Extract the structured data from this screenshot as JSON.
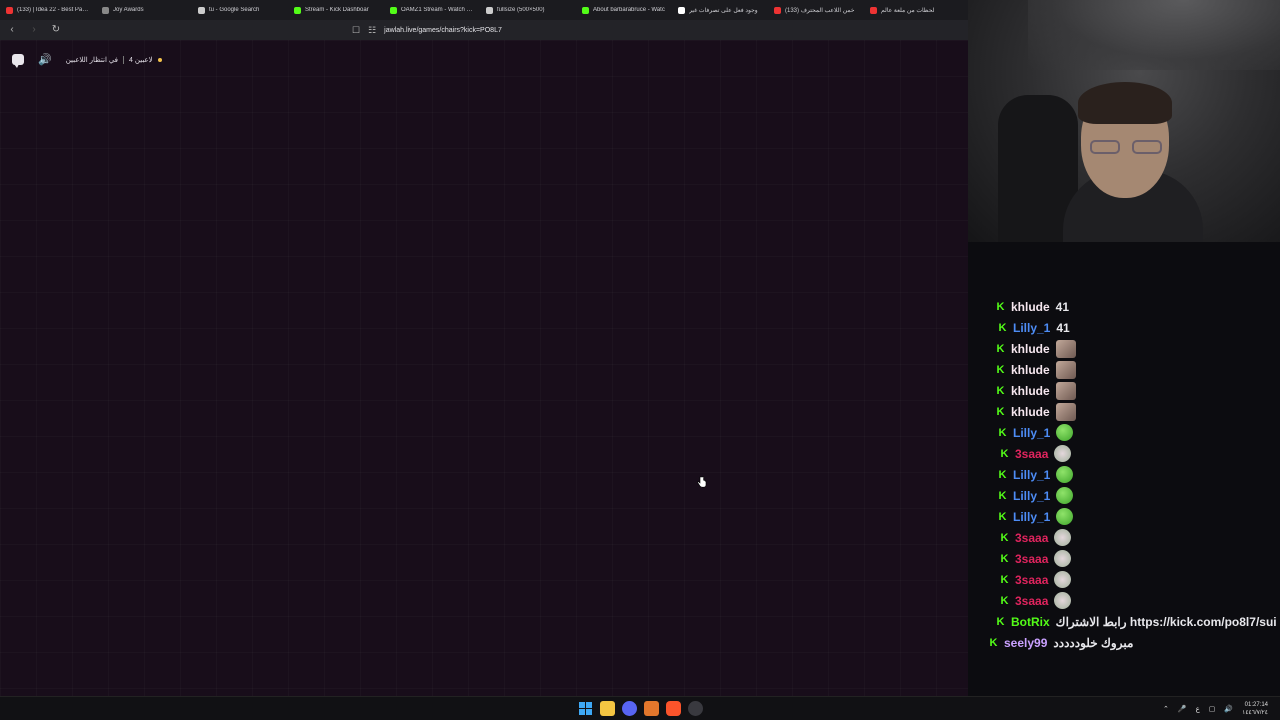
{
  "browser": {
    "tabs": [
      {
        "title": "(133) | Idea 22 - Best Part 0",
        "favicon": "youtube-icon",
        "color": "#e33"
      },
      {
        "title": "Joy Awards",
        "favicon": "joy-icon",
        "color": "#888"
      },
      {
        "title": "tu - Google Search",
        "favicon": "google-icon",
        "color": "#ccc"
      },
      {
        "title": "Stream - Kick Dashboar",
        "favicon": "kick-icon",
        "color": "#53fc18"
      },
      {
        "title": "OAMZ1 Stream - Watch Liv",
        "favicon": "kick-icon",
        "color": "#53fc18"
      },
      {
        "title": "fullsize (500×500)",
        "favicon": "globe-icon",
        "color": "#ccc"
      },
      {
        "title": "About barbarabruce - Watc",
        "favicon": "kick-icon",
        "color": "#53fc18"
      },
      {
        "title": "وجود فعل على تصرفات غير",
        "favicon": "tiktok-icon",
        "color": "#fff"
      },
      {
        "title": "(133) خمن اللاعب المحترف",
        "favicon": "youtube-icon",
        "color": "#e33"
      },
      {
        "title": "لحظات من ملعة عالم",
        "favicon": "youtube-icon",
        "color": "#e33"
      }
    ],
    "url": "jawlah.live/games/chairs?kick=PO8L7"
  },
  "game": {
    "players_label": "4 لاعبين",
    "waiting_label": "في انتظار اللاعبين"
  },
  "chat": [
    {
      "user": "khlude",
      "color": "#f6e7ef",
      "text": "41",
      "emote": ""
    },
    {
      "user": "Lilly_1",
      "color": "#4d8cf5",
      "text": "41",
      "emote": ""
    },
    {
      "user": "khlude",
      "color": "#f6e7ef",
      "text": "",
      "emote": "photo"
    },
    {
      "user": "khlude",
      "color": "#f6e7ef",
      "text": "",
      "emote": "photo"
    },
    {
      "user": "khlude",
      "color": "#f6e7ef",
      "text": "",
      "emote": "photo"
    },
    {
      "user": "khlude",
      "color": "#f6e7ef",
      "text": "",
      "emote": "photo"
    },
    {
      "user": "Lilly_1",
      "color": "#4d8cf5",
      "text": "",
      "emote": "frog"
    },
    {
      "user": "3saaa",
      "color": "#e0245e",
      "text": "",
      "emote": "pig"
    },
    {
      "user": "Lilly_1",
      "color": "#4d8cf5",
      "text": "",
      "emote": "frog"
    },
    {
      "user": "Lilly_1",
      "color": "#4d8cf5",
      "text": "",
      "emote": "frog"
    },
    {
      "user": "Lilly_1",
      "color": "#4d8cf5",
      "text": "",
      "emote": "frog"
    },
    {
      "user": "3saaa",
      "color": "#e0245e",
      "text": "",
      "emote": "pig"
    },
    {
      "user": "3saaa",
      "color": "#e0245e",
      "text": "",
      "emote": "pig"
    },
    {
      "user": "3saaa",
      "color": "#e0245e",
      "text": "",
      "emote": "pig"
    },
    {
      "user": "3saaa",
      "color": "#e0245e",
      "text": "",
      "emote": "pig"
    },
    {
      "user": "BotRix",
      "color": "#53fc18",
      "text": "رابط الاشتراك https://kick.com/po8l7/sui",
      "emote": ""
    },
    {
      "user": "seely99",
      "color": "#c9a0ff",
      "text": "مبروك خلوددددد",
      "emote": ""
    }
  ],
  "system": {
    "lang": "ع",
    "time": "01:27:14",
    "date": "١٤٤٦/٧/٢٤"
  }
}
